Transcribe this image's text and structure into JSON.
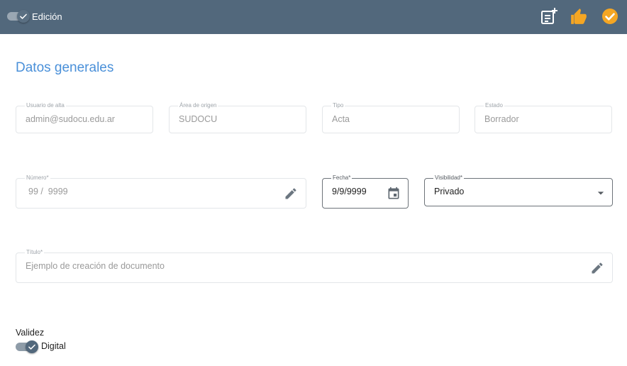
{
  "topbar": {
    "edit_label": "Edición",
    "edit_on": true,
    "icons": [
      "note-add-icon",
      "thumbs-up-icon",
      "check-circle-icon"
    ],
    "accent_color": "#f5a623",
    "bar_color": "#52687c"
  },
  "section": {
    "title": "Datos generales"
  },
  "fields": {
    "usuario": {
      "label": "Usuario de alta",
      "value": "admin@sudocu.edu.ar"
    },
    "area": {
      "label": "Área de origen",
      "value": "SUDOCU"
    },
    "tipo": {
      "label": "Tipo",
      "value": "Acta"
    },
    "estado": {
      "label": "Estado",
      "value": "Borrador"
    },
    "numero": {
      "label": "Número*",
      "value": "99 /  9999"
    },
    "fecha": {
      "label": "Fecha*",
      "value": "9/9/9999"
    },
    "visibilidad": {
      "label": "Visibilidad*",
      "value": "Privado"
    },
    "titulo": {
      "label": "Título*",
      "value": "Ejemplo de creación de documento"
    }
  },
  "validez": {
    "label": "Validez",
    "digital_label": "Digital",
    "digital_on": true
  }
}
